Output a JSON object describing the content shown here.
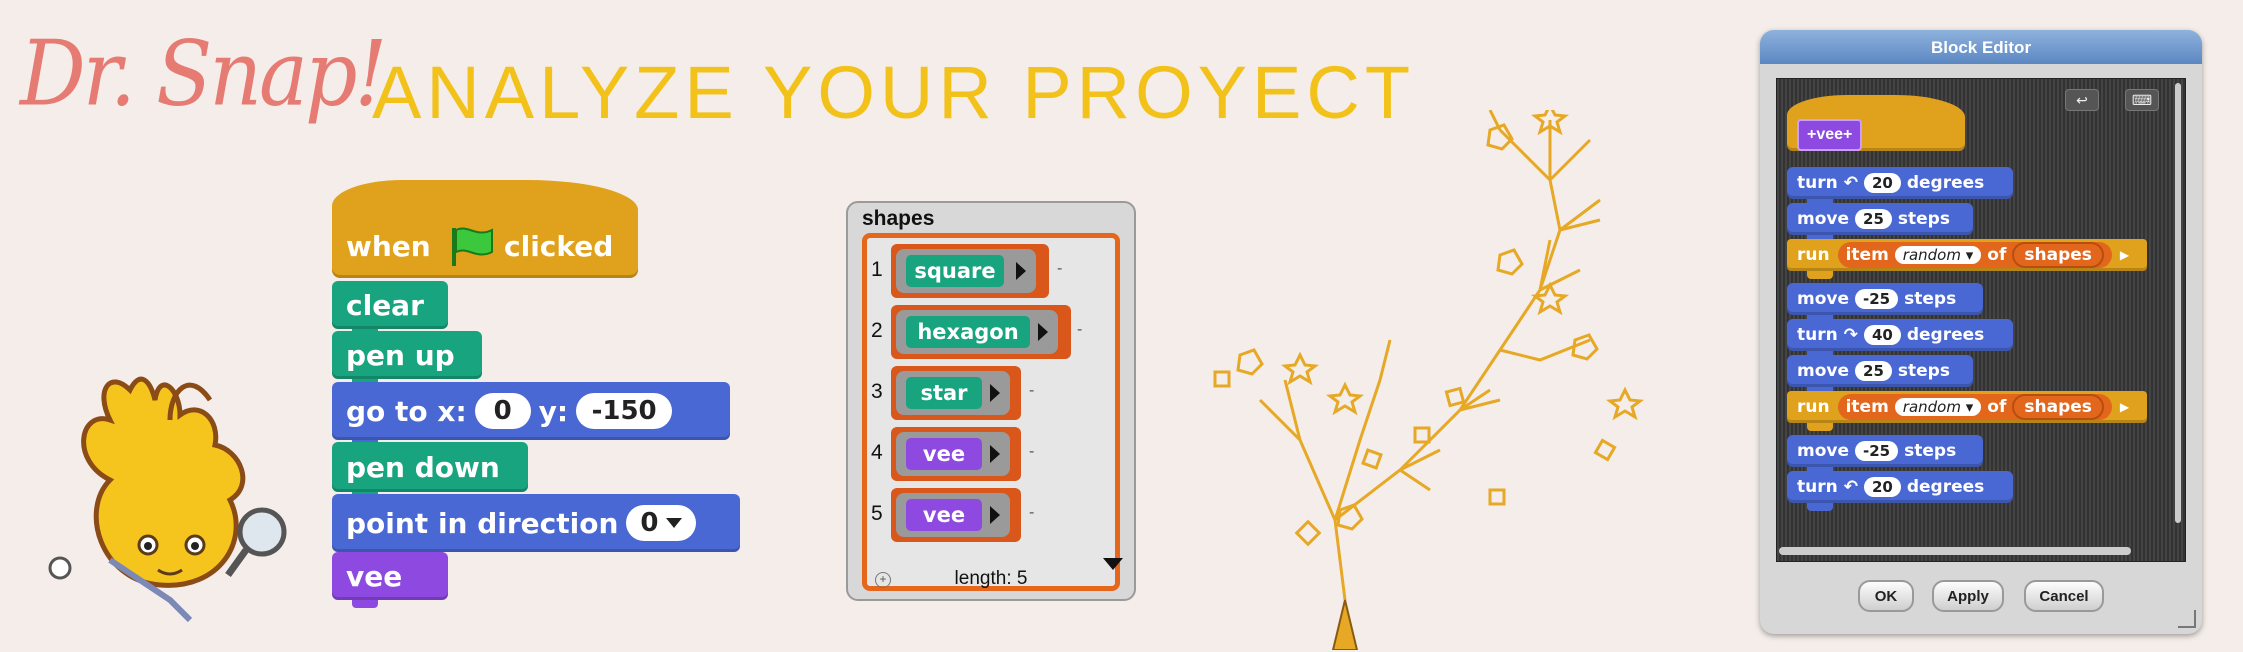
{
  "header": {
    "logo": "Dr. Snap!",
    "title": "ANALYZE YOUR PROYECT"
  },
  "script": {
    "hat_when": "when",
    "hat_clicked": "clicked",
    "clear": "clear",
    "pen_up": "pen up",
    "goto_label_x": "go to x:",
    "goto_x": "0",
    "goto_label_y": "y:",
    "goto_y": "-150",
    "pen_down": "pen down",
    "point_label": "point in direction",
    "point_value": "0",
    "vee": "vee"
  },
  "list_watcher": {
    "title": "shapes",
    "items": [
      {
        "index": "1",
        "label": "square",
        "color": "#18a47f"
      },
      {
        "index": "2",
        "label": "hexagon",
        "color": "#18a47f"
      },
      {
        "index": "3",
        "label": "star",
        "color": "#18a47f"
      },
      {
        "index": "4",
        "label": "vee",
        "color": "#8e49e0"
      },
      {
        "index": "5",
        "label": "vee",
        "color": "#8e49e0"
      }
    ],
    "dash": "-",
    "length": "length: 5",
    "plus": "+"
  },
  "editor": {
    "title": "Block Editor",
    "hat_label": "+vee+",
    "turn": "turn",
    "degrees": "degrees",
    "move": "move",
    "steps": "steps",
    "run": "run",
    "item": "item",
    "random": "random",
    "of": "of",
    "shapes": "shapes",
    "values": [
      "20",
      "25",
      "-25",
      "40",
      "25",
      "-25",
      "20"
    ],
    "ok": "OK",
    "apply": "Apply",
    "cancel": "Cancel"
  },
  "colors": {
    "background": "#f4ede9",
    "title": "#f2c21b",
    "logo": "#e57b72",
    "control": "#e0a21c",
    "pen": "#18a47f",
    "motion": "#4a68d4",
    "custom": "#8e49e0",
    "list": "#e4671c",
    "tree": "#e6a825"
  },
  "icons": [
    "green-flag-icon",
    "rotate-left-icon",
    "rotate-right-icon",
    "undo-icon",
    "keyboard-icon",
    "dropdown-arrow-icon",
    "magnifier-icon"
  ]
}
